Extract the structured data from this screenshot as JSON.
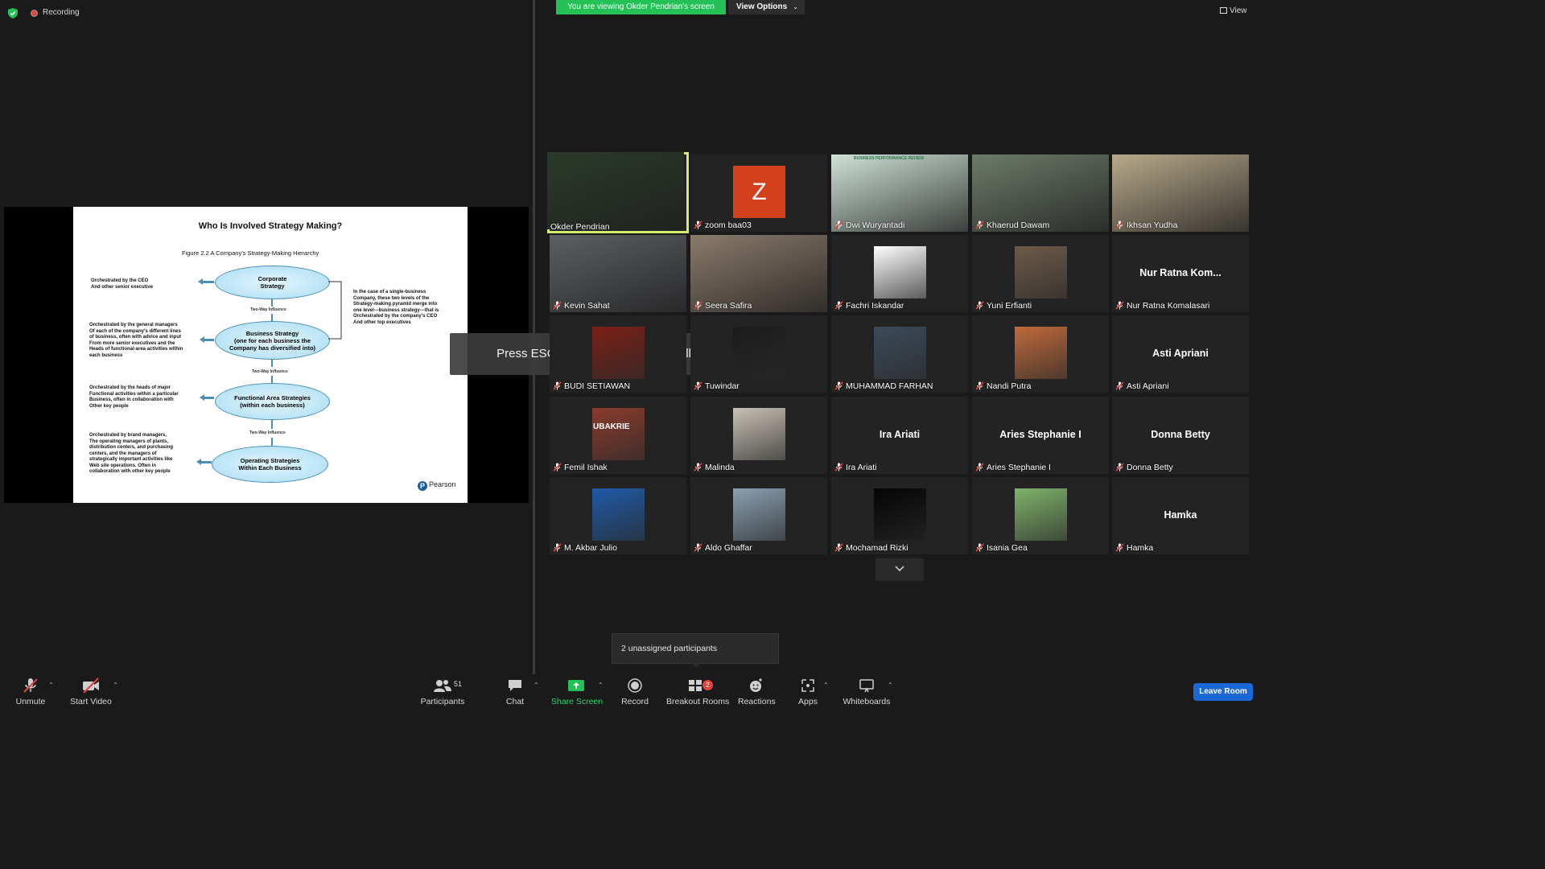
{
  "top": {
    "recording_label": "Recording",
    "viewing_banner": "You are viewing Okder Pendrian's screen",
    "view_options_label": "View Options",
    "view_button": "View"
  },
  "slide": {
    "title": "Who  Is Involved Strategy Making?",
    "figure": "Figure 2.2    A Company's Strategy-Making Hierarchy",
    "levels": [
      {
        "label": "Corporate\nStrategy",
        "note": "Orchestrated by the CEO\nAnd other senior executive"
      },
      {
        "label": "Business Strategy\n(one for each business the\nCompany has diversified into)",
        "note": "Orchestrated by the general managers\nOf each of the company's different lines\nof business, often with advice and input\nFrom more senior executives and the\nHeads of functional-area activities within\neach business"
      },
      {
        "label": "Functional Area Strategies\n(within each business)",
        "note": "Orchestrated by the heads of major\nFunctional activities within a particular\nBusiness, often in collaboration with\nOther key people"
      },
      {
        "label": "Operating Strategies\nWithin Each Business",
        "note": "Orchestrated by brand managers,\nThe operating managers of plants,\ndistribution centers, and purchasing\ncenters, and the managers of\nstrategically important activities like\n Web site operations. Often in\ncollaboration with other key people"
      }
    ],
    "influence_label": "Two-Way Influence",
    "side_note": "In the case of a single-business\nCompany, these two levels of the\nStrategy-making pyramid merge into\none level---business strategy---that is\nOrchestrated by the company's CEO\nAnd other top executives",
    "publisher": "Pearson"
  },
  "esc_message": "Press ESC or double-click to exit full screen mode",
  "participants": [
    {
      "name": "Okder Pendrian",
      "muted": false,
      "active": true,
      "kind": "video",
      "color": "#2b3a2a"
    },
    {
      "name": "zoom baa03",
      "muted": true,
      "kind": "letter",
      "letter": "Z"
    },
    {
      "name": "Dwi Wuryantadi",
      "muted": true,
      "kind": "video",
      "color": "#cfe2d6",
      "overlay": "BUSINESS PERFORMANCE REVIEW"
    },
    {
      "name": "Khaerud Dawam",
      "muted": true,
      "kind": "video",
      "color": "#6d7b6a"
    },
    {
      "name": "Ikhsan Yudha",
      "muted": true,
      "kind": "video",
      "color": "#b7a98a"
    },
    {
      "name": "Kevin Sahat",
      "muted": true,
      "kind": "video",
      "color": "#5c5f63"
    },
    {
      "name": "Seera Safira",
      "muted": true,
      "kind": "video",
      "color": "#8b7b6b"
    },
    {
      "name": "Fachri Iskandar",
      "muted": true,
      "kind": "avatar",
      "color": "#ffffff"
    },
    {
      "name": "Yuni Erfianti",
      "muted": true,
      "kind": "avatar",
      "color": "#6e5a48"
    },
    {
      "name": "Nur Ratna Komalasari",
      "muted": true,
      "kind": "text",
      "display": "Nur Ratna Kom..."
    },
    {
      "name": "BUDI SETIAWAN",
      "muted": true,
      "kind": "avatar",
      "color": "#7a1f16"
    },
    {
      "name": "Tuwindar",
      "muted": true,
      "kind": "avatar",
      "color": "#1c1c1c"
    },
    {
      "name": "MUHAMMAD FARHAN",
      "muted": true,
      "kind": "avatar",
      "color": "#3c4a5a"
    },
    {
      "name": "Nandi Putra",
      "muted": true,
      "kind": "avatar",
      "color": "#c06a3a"
    },
    {
      "name": "Asti Apriani",
      "muted": true,
      "kind": "text",
      "display": "Asti Apriani"
    },
    {
      "name": "Femil Ishak",
      "muted": true,
      "kind": "avatar",
      "color": "#8a3b2c",
      "overlay": "UBAKRIE"
    },
    {
      "name": "Malinda",
      "muted": true,
      "kind": "avatar",
      "color": "#c9c1b6"
    },
    {
      "name": "Ira Ariati",
      "muted": true,
      "kind": "text",
      "display": "Ira Ariati"
    },
    {
      "name": "Aries Stephanie I",
      "muted": true,
      "kind": "text",
      "display": "Aries Stephanie I"
    },
    {
      "name": "Donna Betty",
      "muted": true,
      "kind": "text",
      "display": "Donna Betty"
    },
    {
      "name": "M. Akbar Julio",
      "muted": true,
      "kind": "avatar",
      "color": "#1f5aa8"
    },
    {
      "name": "Aldo Ghaffar",
      "muted": true,
      "kind": "avatar",
      "color": "#8aa0b2"
    },
    {
      "name": "Mochamad Rizki",
      "muted": true,
      "kind": "avatar",
      "color": "#050505"
    },
    {
      "name": "Isania Gea",
      "muted": true,
      "kind": "avatar",
      "color": "#7fb36a"
    },
    {
      "name": "Hamka",
      "muted": true,
      "kind": "text",
      "display": "Hamka"
    }
  ],
  "unassigned_tooltip": "2 unassigned participants",
  "toolbar": {
    "unmute": "Unmute",
    "start_video": "Start Video",
    "participants": "Participants",
    "participants_count": "51",
    "chat": "Chat",
    "share_screen": "Share Screen",
    "record": "Record",
    "breakout_rooms": "Breakout Rooms",
    "breakout_badge": "2",
    "reactions": "Reactions",
    "apps": "Apps",
    "whiteboards": "Whiteboards",
    "leave": "Leave Room"
  },
  "colors": {
    "accent_green": "#23c156",
    "active_speaker": "#d3ec6a",
    "leave_blue": "#1a68d8",
    "muted_red": "#e0473c"
  }
}
